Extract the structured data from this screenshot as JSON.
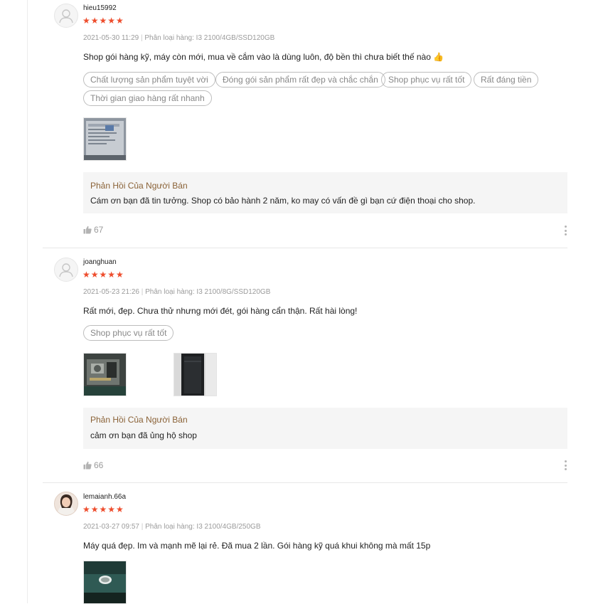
{
  "reviews": [
    {
      "username": "hieu15992",
      "stars": "★★★★★",
      "date": "2021-05-30 11:29",
      "separator": "|",
      "variation": "Phân loại hàng: I3 2100/4GB/SSD120GB",
      "text": "Shop gói hàng kỹ, máy còn mới, mua về cắm vào là dùng luôn, độ bền thì chưa biết thế nào 👍",
      "tags": [
        "Chất lượng sản phẩm tuyệt vời",
        "Đóng gói sản phẩm rất đẹp và chắc chắn",
        "Shop phục vụ rất tốt",
        "Rất đáng tiền",
        "Thời gian giao hàng rất nhanh"
      ],
      "images": [
        "laptop-screen-photo"
      ],
      "reply_title": "Phản Hồi Của Người Bán",
      "reply_text": "Cám ơn bạn đã tin tưởng. Shop có bảo hành 2 năm, ko may có vấn đề gì bạn cứ điện thoại cho shop.",
      "likes": "67"
    },
    {
      "username": "joanghuan",
      "stars": "★★★★★",
      "date": "2021-05-23 21:26",
      "separator": "|",
      "variation": "Phân loại hàng: I3 2100/8G/SSD120GB",
      "text": "Rất mới, đẹp. Chưa thử nhưng mới đét, gói hàng cẩn thận. Rất hài lòng!",
      "tags": [
        "Shop phục vụ rất tốt"
      ],
      "images": [
        "pc-internals-photo",
        "pc-case-photo"
      ],
      "reply_title": "Phản Hồi Của Người Bán",
      "reply_text": "cảm ơn bạn đã ủng hộ shop",
      "likes": "66"
    },
    {
      "username": "lemaianh.66a",
      "stars": "★★★★★",
      "date": "2021-03-27 09:57",
      "separator": "|",
      "variation": "Phân loại hàng: I3 2100/4GB/250GB",
      "text": "Máy quá đẹp. Im và mạnh mẽ lại rẻ. Đã mua 2 lần. Gói hàng kỹ quá khui không mà mất 15p",
      "tags": [],
      "images": [
        "dell-pc-photo"
      ]
    }
  ],
  "icons": {
    "avatar_placeholder": "user-icon",
    "like": "thumbs-up-icon",
    "more": "more-vertical-icon"
  },
  "colors": {
    "star": "#ee4d2d",
    "reply_title": "#8a6237",
    "reply_bg": "#f5f5f5"
  }
}
